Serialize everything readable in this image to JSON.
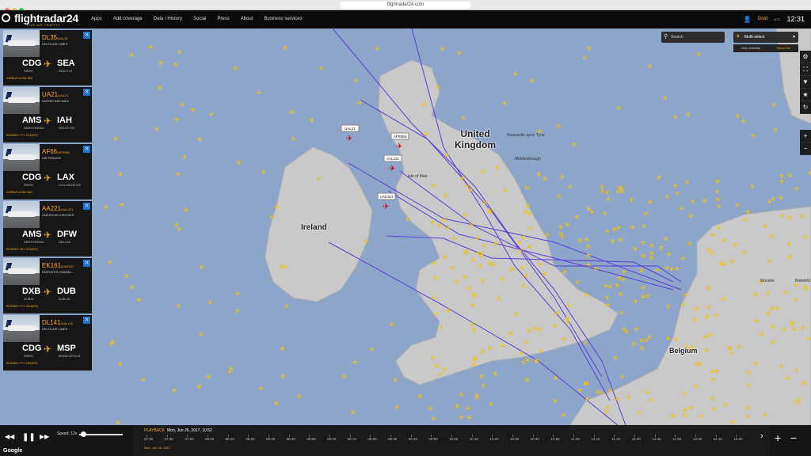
{
  "browser": {
    "url": "flightradar24.com"
  },
  "header": {
    "logo": "flightradar24",
    "logo_sub": "LIVE AIR TRAFFIC",
    "nav": [
      "Apps",
      "Add coverage",
      "Data / History",
      "Social",
      "Press",
      "About",
      "Business services"
    ],
    "user": "Gold",
    "utc": "UTC",
    "clock": "12:31"
  },
  "search": {
    "placeholder": "Search"
  },
  "multiselect": {
    "label": "Multi-select",
    "opt1": "Only selected",
    "opt2": "Show info"
  },
  "map": {
    "countries": [
      "United Kingdom",
      "Ireland",
      "Belgium"
    ],
    "cities": [
      "Newcastle upon Tyne",
      "Middlesbrough",
      "Isle of Man",
      "Bielefeld",
      "Münster"
    ],
    "selected_flights": [
      "UAL21",
      "AFR066",
      "AAL221",
      "UAE161"
    ]
  },
  "cards": [
    {
      "flight": "DL35",
      "callsign": "/DAL35",
      "airline": "DELTA AIR LINES",
      "from": "CDG",
      "from_city": "PARIS",
      "to": "SEA",
      "to_city": "SEATTLE",
      "aircraft": "AIRBUS A330-302"
    },
    {
      "flight": "UA21",
      "callsign": "/UAL21",
      "airline": "UNITED AIRLINES",
      "from": "AMS",
      "from_city": "AMSTERDAM",
      "to": "IAH",
      "to_city": "HOUSTON",
      "aircraft": "BOEING 777-224(ER)"
    },
    {
      "flight": "AF66",
      "callsign": "/AFR066",
      "airline": "AIR FRANCE",
      "from": "CDG",
      "from_city": "PARIS",
      "to": "LAX",
      "to_city": "LOS ANGELES",
      "aircraft": "AIRBUS A380-861"
    },
    {
      "flight": "AA221",
      "callsign": "/AAL221",
      "airline": "AMERICAN AIRLINES",
      "from": "AMS",
      "from_city": "AMSTERDAM",
      "to": "DFW",
      "to_city": "DALLAS",
      "aircraft": "BOEING 767-323(ER)"
    },
    {
      "flight": "EK161",
      "callsign": "/UAE161",
      "airline": "EMIRATES (HAMBU...",
      "from": "DXB",
      "from_city": "DUBAI",
      "to": "DUB",
      "to_city": "DUBLIN",
      "aircraft": "BOEING 777-31H(ER)"
    },
    {
      "flight": "DL141",
      "callsign": "/DAL141",
      "airline": "DELTA AIR LINES",
      "from": "CDG",
      "from_city": "PARIS",
      "to": "MSP",
      "to_city": "MINNEAPOLIS",
      "aircraft": "BOEING 777-232(ER)"
    }
  ],
  "playback": {
    "label": "PLAYBACK",
    "current": "Mon, Jun 26, 2017, 10:52",
    "start": "Mon, Jun 26, 2017",
    "speed_label": "Speed: 12x",
    "speed_fraction": 0.05,
    "ticks": [
      "07:30",
      "07:40",
      "07:50",
      "08:00",
      "08:10",
      "08:20",
      "08:30",
      "08:40",
      "08:50",
      "09:00",
      "09:10",
      "09:20",
      "09:30",
      "09:40",
      "09:50",
      "10:00",
      "10:10",
      "10:20",
      "10:30",
      "10:40",
      "10:50",
      "11:00",
      "11:10",
      "11:20",
      "11:30",
      "11:40",
      "11:50",
      "12:00",
      "12:10",
      "12:20"
    ]
  },
  "footer": {
    "google": "Google"
  },
  "colors": {
    "accent": "#f5a623",
    "sea": "#8ea5ca",
    "land": "#c9c9c9",
    "track": "#5b3fd6"
  }
}
